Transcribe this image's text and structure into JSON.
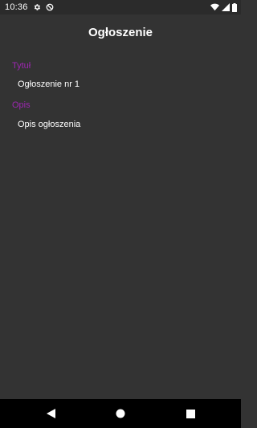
{
  "status_bar": {
    "time": "10:36",
    "icons_left": [
      "gear-icon",
      "no-sync-icon"
    ],
    "icons_right": [
      "wifi-icon",
      "signal-icon",
      "battery-icon"
    ]
  },
  "header": {
    "title": "Ogłoszenie"
  },
  "fields": [
    {
      "label": "Tytuł",
      "value": "Ogłoszenie nr 1"
    },
    {
      "label": "Opis",
      "value": "Opis ogłoszenia"
    }
  ],
  "nav_bar": {
    "buttons": [
      "back-icon",
      "home-icon",
      "recents-icon"
    ]
  },
  "colors": {
    "background": "#333333",
    "accent": "#9c27b0",
    "text": "#ffffff",
    "nav_bar": "#000000"
  }
}
